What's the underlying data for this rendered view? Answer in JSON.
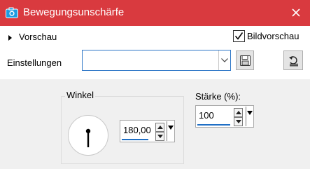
{
  "window": {
    "title": "Bewegungsunschärfe",
    "title_color": "#d93a3f",
    "app_icon": "camera-icon",
    "close_icon": "close-icon"
  },
  "top": {
    "preview_label": "Vorschau",
    "preview_toggle_icon": "triangle-right-icon",
    "image_preview_label": "Bildvorschau",
    "image_preview_checked": true
  },
  "settings": {
    "label": "Einstellungen",
    "selected_value": "",
    "save_icon": "save-icon",
    "reset_icon": "reset-icon"
  },
  "angle": {
    "group_label": "Winkel",
    "value": "180,00",
    "dial_degrees": 180
  },
  "strength": {
    "label": "Stärke (%):",
    "value": "100"
  }
}
